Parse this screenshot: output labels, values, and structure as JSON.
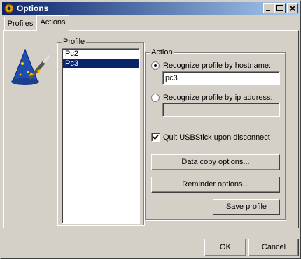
{
  "window": {
    "title": "Options"
  },
  "tabs": [
    {
      "label": "Profiles"
    },
    {
      "label": "Actions"
    }
  ],
  "profile": {
    "group_label": "Profile",
    "items": [
      {
        "label": "Pc2"
      },
      {
        "label": "Pc3"
      }
    ],
    "selected": "Pc3"
  },
  "action": {
    "group_label": "Action",
    "hostname_radio": {
      "label": "Recognize profile by hostname:",
      "checked": true
    },
    "hostname_value": "pc3",
    "ip_radio": {
      "label": "Recognize profile by ip address:",
      "checked": false
    },
    "ip_value": "",
    "quit_checkbox": {
      "label": "Quit USBStick upon disconnect",
      "checked": true
    },
    "data_copy_button": "Data copy options...",
    "reminder_button": "Reminder options...",
    "save_button": "Save profile"
  },
  "footer": {
    "ok_button": "OK",
    "cancel_button": "Cancel"
  },
  "icons": {
    "title": "gear-icon",
    "wizard": "wizard-hat-icon"
  },
  "colors": {
    "titlebar_start": "#0a246a",
    "titlebar_end": "#a6caf0",
    "selection": "#0a246a",
    "face": "#d4d0c8"
  }
}
